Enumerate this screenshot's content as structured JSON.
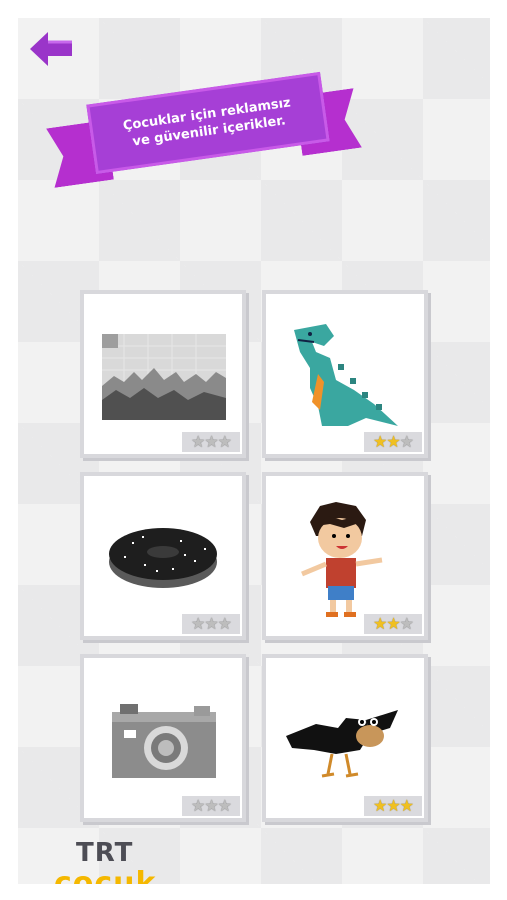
{
  "banner": {
    "line1": "Çocuklar için reklamsız",
    "line2": "ve güvenilir içerikler."
  },
  "colors": {
    "accent": "#a63fd6",
    "star_on": "#f0c020",
    "star_off": "#bdbdbd"
  },
  "cards": [
    {
      "name": "landscape",
      "stars": 0
    },
    {
      "name": "dinosaur",
      "stars": 2
    },
    {
      "name": "donut",
      "stars": 0
    },
    {
      "name": "boy",
      "stars": 2
    },
    {
      "name": "camera",
      "stars": 0
    },
    {
      "name": "crow",
      "stars": 3
    }
  ],
  "logo": {
    "line1": "TRT",
    "line2": "çocuk"
  },
  "icons": [
    "back-arrow-icon",
    "star-icon"
  ]
}
